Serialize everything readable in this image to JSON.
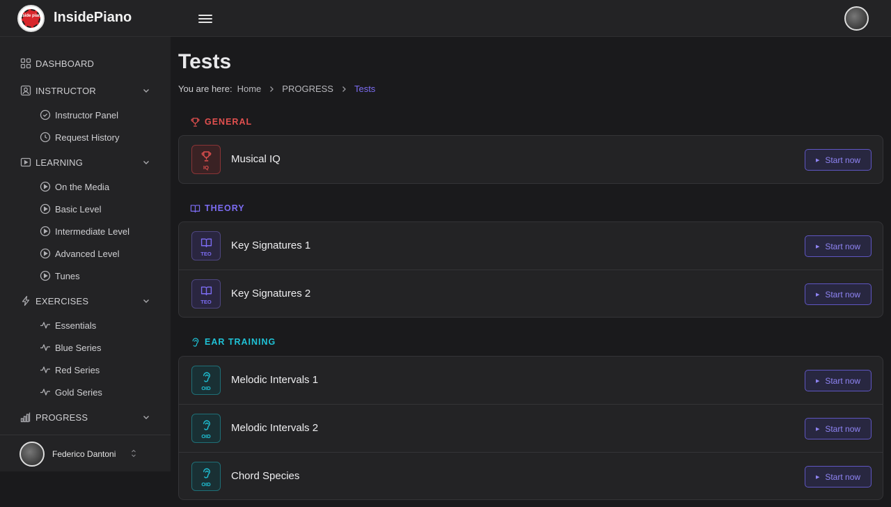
{
  "app": {
    "brand": "InsidePiano",
    "logo_text": "inside piano"
  },
  "sidebar": {
    "sections": [
      {
        "label": "DASHBOARD",
        "icon": "grid-icon"
      },
      {
        "label": "INSTRUCTOR",
        "icon": "user-square-icon",
        "items": [
          {
            "label": "Instructor Panel",
            "icon": "check-circle-icon"
          },
          {
            "label": "Request History",
            "icon": "clock-icon"
          }
        ]
      },
      {
        "label": "LEARNING",
        "icon": "video-icon",
        "items": [
          {
            "label": "On the Media",
            "icon": "play-circle-icon"
          },
          {
            "label": "Basic Level",
            "icon": "play-circle-icon"
          },
          {
            "label": "Intermediate Level",
            "icon": "play-circle-icon"
          },
          {
            "label": "Advanced Level",
            "icon": "play-circle-icon"
          },
          {
            "label": "Tunes",
            "icon": "play-circle-icon"
          }
        ]
      },
      {
        "label": "EXERCISES",
        "icon": "bolt-icon",
        "items": [
          {
            "label": "Essentials",
            "icon": "pulse-icon"
          },
          {
            "label": "Blue Series",
            "icon": "pulse-icon"
          },
          {
            "label": "Red Series",
            "icon": "pulse-icon"
          },
          {
            "label": "Gold Series",
            "icon": "pulse-icon"
          }
        ]
      },
      {
        "label": "PROGRESS",
        "icon": "bar-chart-icon"
      }
    ],
    "user": {
      "name": "Federico Dantoni"
    }
  },
  "main": {
    "title": "Tests",
    "breadcrumb": {
      "prefix": "You are here:",
      "items": [
        "Home",
        "PROGRESS",
        "Tests"
      ]
    },
    "categories": [
      {
        "label": "GENERAL",
        "color": "#e2504f",
        "icon": "trophy-icon",
        "tests": [
          {
            "title": "Musical IQ",
            "badge": "IQ",
            "button": "Start now"
          }
        ]
      },
      {
        "label": "THEORY",
        "color": "#7c6cf2",
        "icon": "book-icon",
        "tests": [
          {
            "title": "Key Signatures 1",
            "badge": "TEO",
            "button": "Start now"
          },
          {
            "title": "Key Signatures 2",
            "badge": "TEO",
            "button": "Start now"
          }
        ]
      },
      {
        "label": "EAR TRAINING",
        "color": "#1fc2d6",
        "icon": "ear-icon",
        "tests": [
          {
            "title": "Melodic Intervals 1",
            "badge": "OID",
            "button": "Start now"
          },
          {
            "title": "Melodic Intervals 2",
            "badge": "OID",
            "button": "Start now"
          },
          {
            "title": "Chord Species",
            "badge": "OID",
            "button": "Start now"
          }
        ]
      }
    ]
  }
}
